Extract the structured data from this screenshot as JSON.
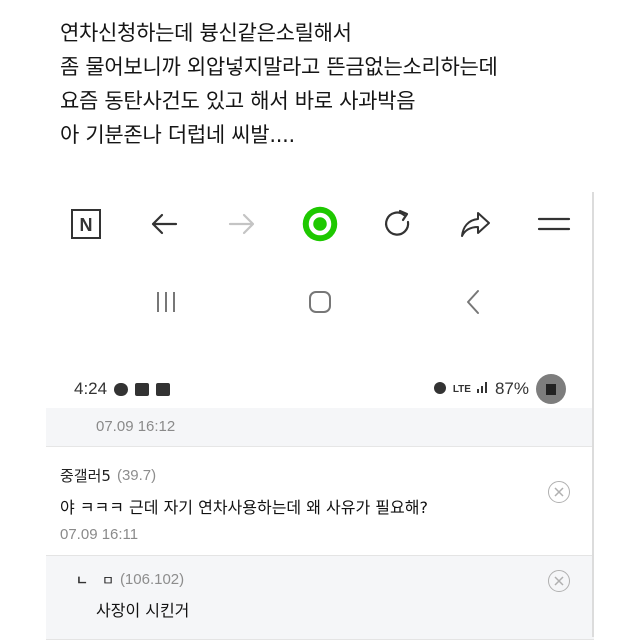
{
  "caption": {
    "lines": [
      "연차신청하는데 븅신같은소릴해서",
      "좀 물어보니까 외압넣지말라고 뜬금없는소리하는데",
      "요즘 동탄사건도 있고 해서 바로 사과박음",
      "아 기분존나 더럽네 씨발...."
    ]
  },
  "browser": {
    "logo_letter": "N",
    "icons": [
      "naver-logo-icon",
      "back-arrow-icon",
      "forward-arrow-icon",
      "green-record-icon",
      "reload-icon",
      "share-icon",
      "menu-icon"
    ],
    "accent_color": "#1ec800"
  },
  "system_nav": {
    "icons": [
      "recent-apps-icon",
      "home-icon",
      "back-icon"
    ]
  },
  "status": {
    "time": "4:24",
    "battery": "87%",
    "network": "LTE"
  },
  "comments": {
    "previous_date": "07.09 16:12",
    "items": [
      {
        "nickname": "중갤러5",
        "ip": "(39.7)",
        "text": "야 ㅋㅋㅋ 근데 자기 연차사용하는데 왜 사유가 필요해?",
        "date": "07.09 16:11"
      },
      {
        "reply_mark": "ㄴ",
        "nickname": "ㅁ",
        "ip": "(106.102)",
        "text": "사장이 시킨거"
      }
    ]
  }
}
